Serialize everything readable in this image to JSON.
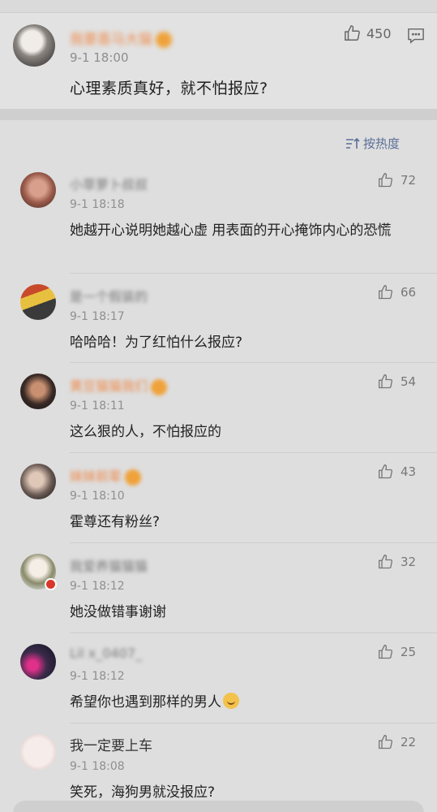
{
  "main_comment": {
    "name": "我要喜马大猫",
    "time": "9-1 18:00",
    "text": "心理素质真好，就不怕报应?",
    "likes": "450"
  },
  "sort": {
    "label": "按热度"
  },
  "comments": [
    {
      "name": "小草萝卜叔叔",
      "time": "9-1 18:18",
      "text": "她越开心说明她越心虚 用表面的开心掩饰内心的恐慌",
      "likes": "72"
    },
    {
      "name": "是一个假装的",
      "time": "9-1 18:17",
      "text": "哈哈哈！为了红怕什么报应?",
      "likes": "66"
    },
    {
      "name": "黄豆猫猫我们",
      "time": "9-1 18:11",
      "text": "这么狠的人，不怕报应的",
      "likes": "54"
    },
    {
      "name": "妹妹前辈",
      "time": "9-1 18:10",
      "text": "霍尊还有粉丝?",
      "likes": "43"
    },
    {
      "name": "我爱养猫猫猫",
      "time": "9-1 18:12",
      "text": "她没做错事谢谢",
      "likes": "32"
    },
    {
      "name": "Lil x_0407_",
      "time": "9-1 18:12",
      "text": "希望你也遇到那样的男人",
      "likes": "25"
    },
    {
      "name": "我一定要上车",
      "time": "9-1 18:08",
      "text": "笑死，海狗男就没报应?",
      "likes": "22"
    }
  ],
  "colors": {
    "accent": "#5a6f98",
    "name_orange": "#ef8a4a"
  }
}
